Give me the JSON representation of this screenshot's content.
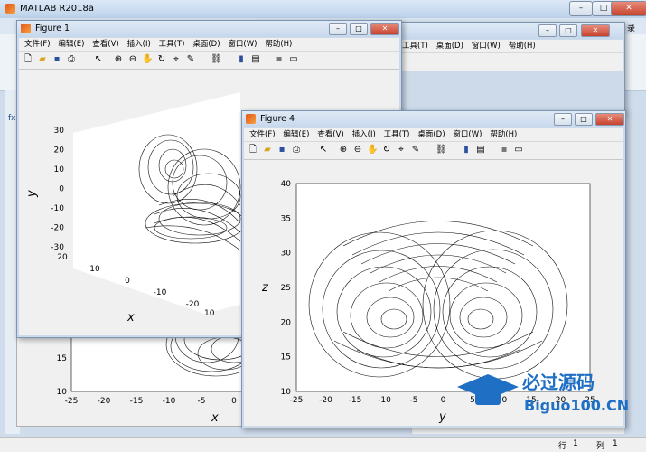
{
  "app": {
    "title": "MATLAB R2018a"
  },
  "menu": [
    "文件(F)",
    "编辑(E)",
    "查看(V)",
    "插入(I)",
    "工具(T)",
    "桌面(D)",
    "窗口(W)",
    "帮助(H)"
  ],
  "fig1": {
    "title": "Figure 1",
    "y_label": "y",
    "x_label": "x",
    "y_ticks": [
      "30",
      "20",
      "10",
      "0",
      "-10",
      "-20",
      "-30"
    ],
    "x_ticks": [
      "20",
      "10",
      "0",
      "-10",
      "-20"
    ],
    "bottom_tick": "10"
  },
  "fig4": {
    "title": "Figure 4",
    "chart_data": {
      "type": "line",
      "xlabel": "y",
      "ylabel": "z",
      "xlim": [
        -25,
        25
      ],
      "ylim": [
        10,
        40
      ],
      "x_ticks": [
        "-25",
        "-20",
        "-15",
        "-10",
        "-5",
        "0",
        "5",
        "10",
        "15",
        "20",
        "25"
      ],
      "y_ticks": [
        "40",
        "35",
        "30",
        "25",
        "20",
        "15",
        "10"
      ]
    }
  },
  "back_plot": {
    "x_ticks": [
      "-25",
      "-20",
      "-15",
      "-10",
      "-5",
      "0"
    ],
    "y_ticks": [
      "15",
      "10"
    ],
    "xlabel": "x"
  },
  "status": {
    "row_label": "行",
    "row": "1",
    "col_label": "列",
    "col": "1"
  },
  "side_labels": {
    "fx": "fx",
    "top_char": "录"
  },
  "watermark": {
    "text": "必过源码",
    "sub": "Biguo100.CN"
  }
}
